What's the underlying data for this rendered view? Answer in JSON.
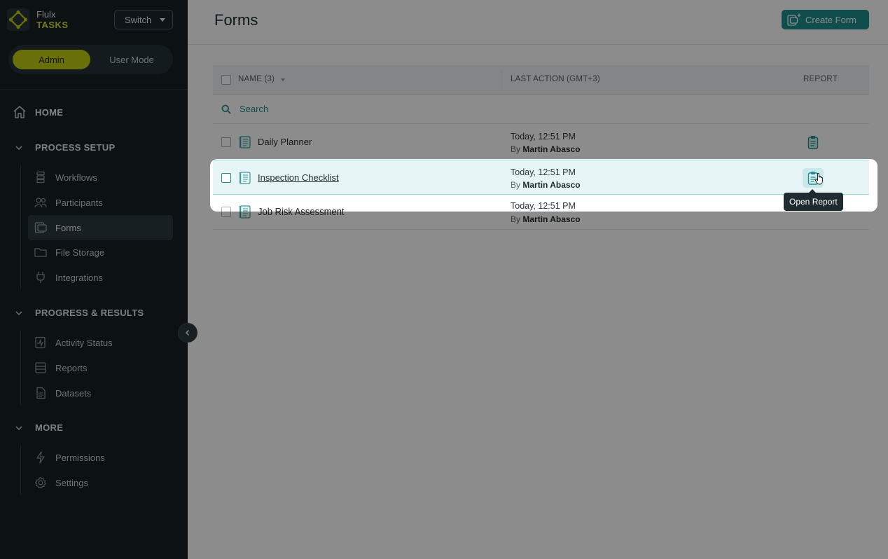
{
  "brand": {
    "name_top": "Flulx",
    "name_bottom": "TASKS"
  },
  "switch": {
    "label": "Switch"
  },
  "mode": {
    "admin": "Admin",
    "user": "User Mode"
  },
  "nav": {
    "home": "HOME",
    "sections": [
      {
        "title": "PROCESS SETUP",
        "items": [
          "Workflows",
          "Participants",
          "Forms",
          "File Storage",
          "Integrations"
        ]
      },
      {
        "title": "PROGRESS & RESULTS",
        "items": [
          "Activity Status",
          "Reports",
          "Datasets"
        ]
      },
      {
        "title": "MORE",
        "items": [
          "Permissions",
          "Settings"
        ]
      }
    ],
    "active_item": "Forms"
  },
  "page": {
    "title": "Forms",
    "create_button": "Create Form"
  },
  "table": {
    "headers": {
      "name": "NAME (3)",
      "last_action": "LAST ACTION (GMT+3)",
      "report": "REPORT"
    },
    "search_placeholder": "Search",
    "rows": [
      {
        "name": "Daily Planner",
        "action_time": "Today, 12:51 PM",
        "action_by_prefix": "By",
        "action_by": "Martin Abasco"
      },
      {
        "name": "Inspection Checklist",
        "action_time": "Today, 12:51 PM",
        "action_by_prefix": "By",
        "action_by": "Martin Abasco"
      },
      {
        "name": "Job Risk Assessment",
        "action_time": "Today, 12:51 PM",
        "action_by_prefix": "By",
        "action_by": "Martin Abasco"
      }
    ]
  },
  "tooltip": {
    "text": "Open Report"
  },
  "colors": {
    "sidebar_bg": "#162125",
    "accent_yellow": "#c2cc12",
    "accent_teal": "#1e8c8c"
  }
}
